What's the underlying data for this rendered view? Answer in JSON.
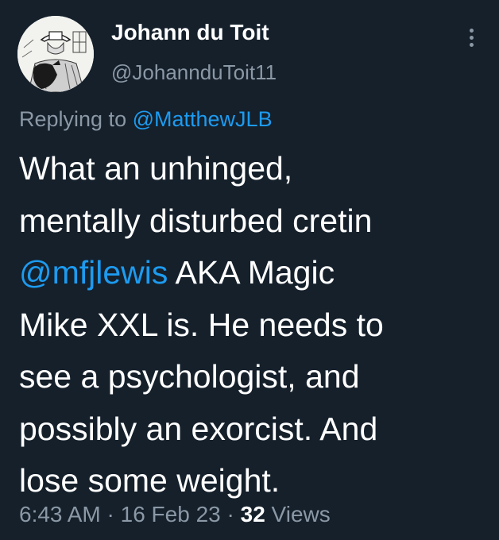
{
  "author": {
    "display_name": "Johann du Toit",
    "handle": "@JohannduToit11",
    "avatar_icon": "sketch-portrait-avatar"
  },
  "more_icon": "more-vertical-icon",
  "reply": {
    "prefix": "Replying to",
    "mention": "@MatthewJLB"
  },
  "body": {
    "line1": "What an unhinged,",
    "line2": "mentally disturbed cretin",
    "line3_mention": "@mfjlewis",
    "line3_rest": " AKA Magic",
    "line4": "Mike XXL is. He needs to",
    "line5": "see a psychologist, and",
    "line6": "possibly an exorcist. And",
    "line7": "lose some weight."
  },
  "meta": {
    "time": "6:43 AM",
    "sep1": " · ",
    "date": "16 Feb 23",
    "sep2": " · ",
    "views_count": "32",
    "views_label": " Views"
  },
  "colors": {
    "background": "#15202b",
    "text": "#ffffff",
    "secondary": "#8b98a5",
    "link": "#1d9bf0"
  }
}
